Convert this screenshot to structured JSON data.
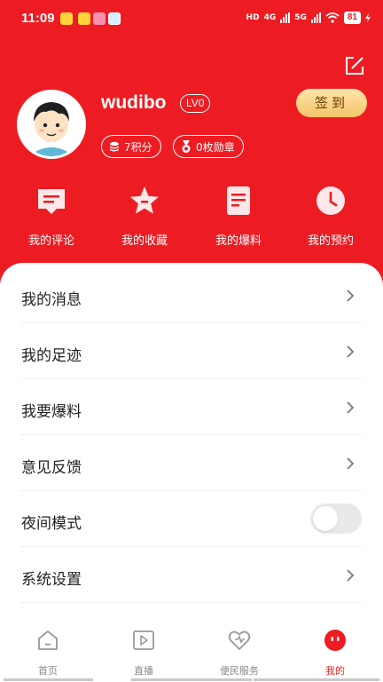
{
  "status": {
    "time": "11:09",
    "network_label": "HD",
    "signal_1": "4G",
    "signal_2": "5G",
    "battery": "81"
  },
  "profile": {
    "username": "wudibo",
    "level": "LV0",
    "signin_label": "签到",
    "points": "7积分",
    "medals": "0枚勋章"
  },
  "quick_actions": [
    {
      "label": "我的评论",
      "icon": "comment-icon"
    },
    {
      "label": "我的收藏",
      "icon": "star-icon"
    },
    {
      "label": "我的爆料",
      "icon": "document-icon"
    },
    {
      "label": "我的预约",
      "icon": "clock-icon"
    }
  ],
  "menu": [
    {
      "label": "我的消息",
      "type": "link"
    },
    {
      "label": "我的足迹",
      "type": "link"
    },
    {
      "label": "我要爆料",
      "type": "link"
    },
    {
      "label": "意见反馈",
      "type": "link"
    },
    {
      "label": "夜间模式",
      "type": "toggle",
      "on": false
    },
    {
      "label": "系统设置",
      "type": "link"
    }
  ],
  "tabs": [
    {
      "label": "首页",
      "icon": "home-icon",
      "active": false
    },
    {
      "label": "直播",
      "icon": "play-icon",
      "active": false
    },
    {
      "label": "便民服务",
      "icon": "heart-icon",
      "active": false
    },
    {
      "label": "我的",
      "icon": "profile-face-icon",
      "active": true
    }
  ],
  "colors": {
    "brand_red": "#ed1c23",
    "signin_gold": "#f3c46a",
    "tab_inactive": "#888888"
  }
}
